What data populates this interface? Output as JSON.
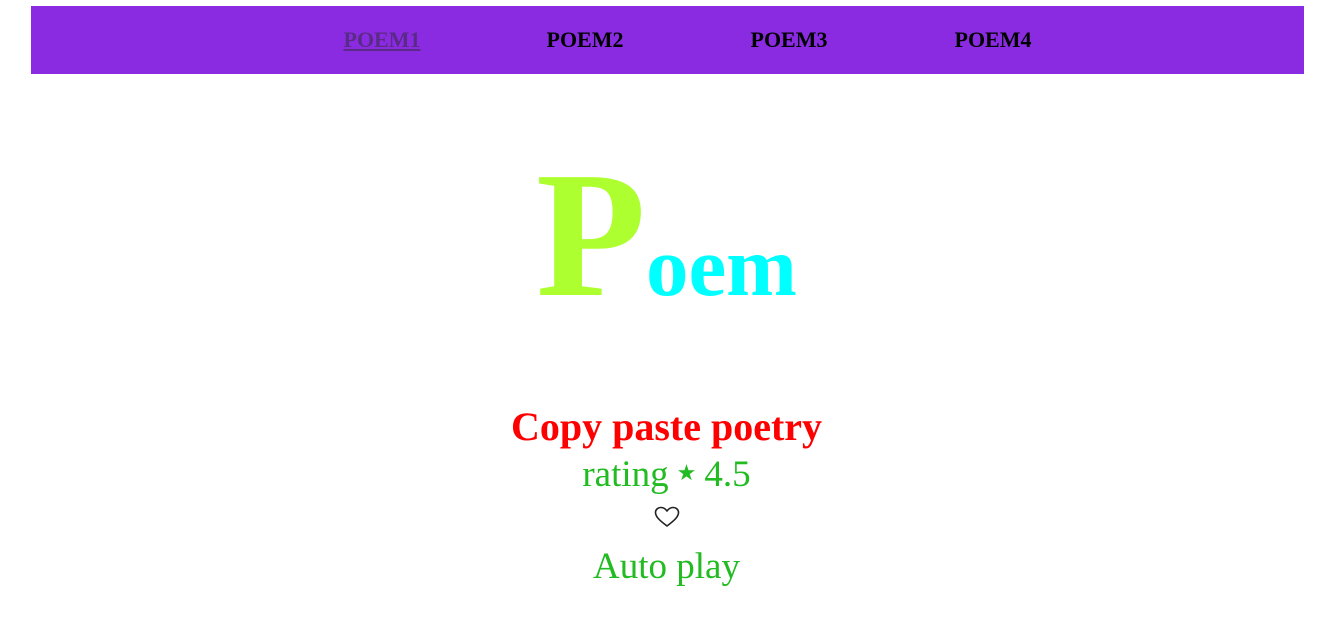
{
  "nav": {
    "items": [
      {
        "label": "POEM1",
        "active": true
      },
      {
        "label": "POEM2",
        "active": false
      },
      {
        "label": "POEM3",
        "active": false
      },
      {
        "label": "POEM4",
        "active": false
      }
    ]
  },
  "hero": {
    "first_letter": "P",
    "rest": "oem"
  },
  "poem": {
    "subtitle": "Copy paste poetry",
    "rating_label": "rating",
    "rating_star": "★",
    "rating_value": "4.5",
    "favorite_icon": "heart-outline-icon",
    "autoplay_label": "Auto play"
  },
  "colors": {
    "nav_background": "#8a2be2",
    "hero_first_letter": "#adff2f",
    "hero_rest": "#00ffff",
    "subtitle": "#ff0000",
    "rating_text": "#22bb22"
  }
}
